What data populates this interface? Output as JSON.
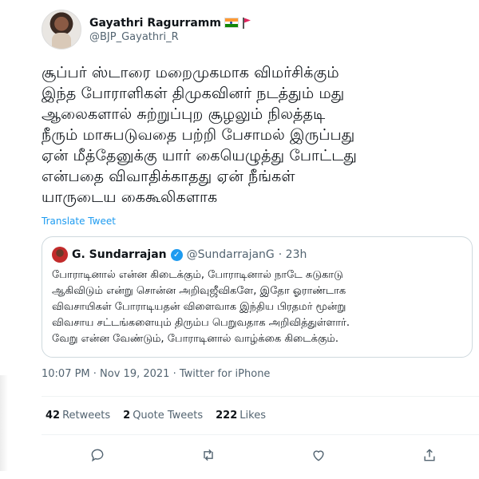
{
  "author": {
    "display_name": "Gayathri Ragurramm",
    "handle": "@BJP_Gayathri_R"
  },
  "tweet": {
    "text": "சூப்பர் ஸ்டாரை மறைமுகமாக விமர்சிக்கும்\nஇந்த போராளிகள் திமுகவினர் நடத்தும் மது\nஆலைகளால் சுற்றுப்புற சூழலும் நிலத்தடி\nநீரும் மாசுபடுவதை பற்றி பேசாமல் இருப்பது\nஏன் மீத்தேனுக்கு யார் கையெழுத்து போட்டது\nஎன்பதை விவாதிக்காதது ஏன் நீங்கள்\nயாருடைய கைகூலிகளாக",
    "translate_label": "Translate Tweet",
    "timestamp": "10:07 PM · Nov 19, 2021 · Twitter for iPhone"
  },
  "quoted": {
    "display_name": "G. Sundarrajan",
    "handle": "@SundarrajanG",
    "age": "· 23h",
    "text": "போராடினால் என்ன கிடைக்கும், போராடினால் நாடே சுடுகாடு\nஆகிவிடும் என்று சொன்ன அறிவுஜீவிகளே, இதோ ஓராண்டாக\nவிவசாயிகள் போராடியதன் விளைவாக இந்திய பிரதமர் மூன்று\nவிவசாய சட்டங்களையும் திரும்ப பெறுவதாக அறிவித்துள்ளார்.\nவேறு என்ன வேண்டும், போராடினால் வாழ்க்கை கிடைக்கும்."
  },
  "stats": {
    "retweets_count": "42",
    "retweets_label": "Retweets",
    "quotes_count": "2",
    "quotes_label": "Quote Tweets",
    "likes_count": "222",
    "likes_label": "Likes"
  },
  "icons": {
    "reply": "reply-icon",
    "retweet": "retweet-icon",
    "like": "like-icon",
    "share": "share-icon"
  },
  "colors": {
    "link": "#1d9bf0",
    "secondary_text": "#536471",
    "border": "#cfd9de"
  }
}
